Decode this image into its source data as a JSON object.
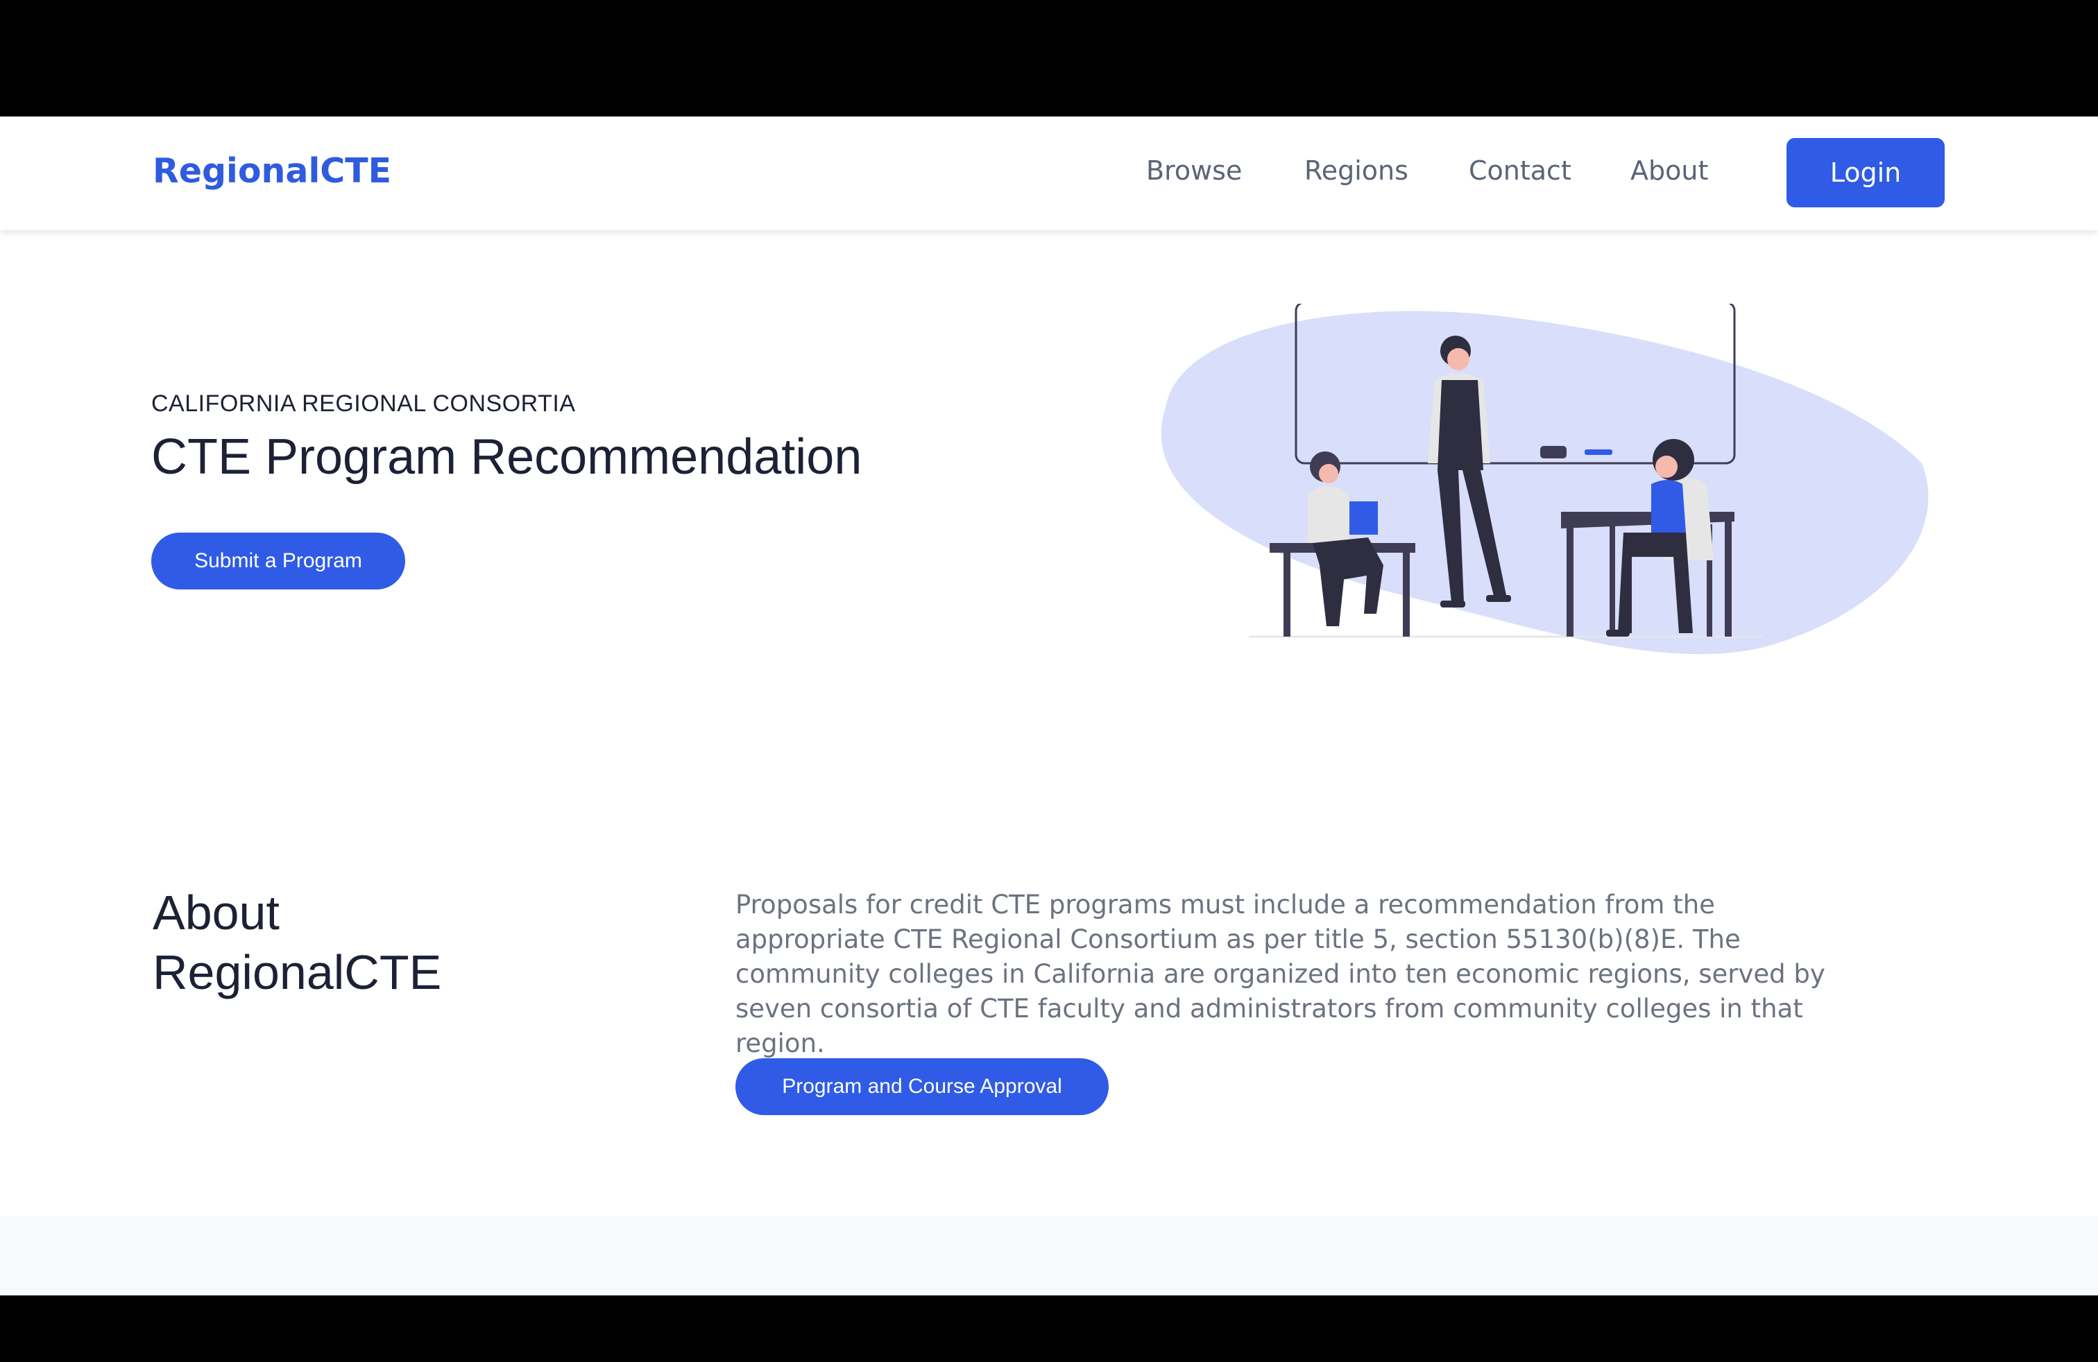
{
  "nav": {
    "brand": "RegionalCTE",
    "links": [
      "Browse",
      "Regions",
      "Contact",
      "About"
    ],
    "login_label": "Login"
  },
  "hero": {
    "eyebrow": "CALIFORNIA REGIONAL CONSORTIA",
    "title": "CTE Program Recommendation",
    "cta_label": "Submit a Program"
  },
  "about": {
    "title_line1": "About",
    "title_line2": "RegionalCTE",
    "body": "Proposals for credit CTE programs must include a recommendation from the appropriate CTE Regional Consortium as per title 5, section 55130(b)(8)E. The community colleges in California are organized into ten economic regions, served by seven consortia of CTE faculty and administrators from community colleges in that region.",
    "cta_label": "Program and Course Approval"
  },
  "colors": {
    "accent": "#2f5be6",
    "heading": "#1c2135",
    "body_text": "#6b7280",
    "illustration_blob": "#d9defa"
  }
}
